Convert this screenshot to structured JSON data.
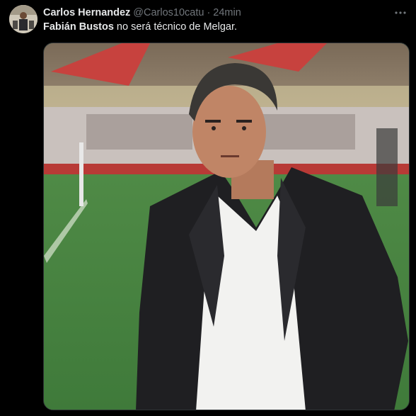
{
  "tweet": {
    "author_name": "Carlos Hernandez",
    "handle": "@Carlos10catu",
    "separator": "·",
    "time": "24min",
    "text_bold": "Fabián Bustos",
    "text_rest": " no será técnico de Melgar."
  },
  "icons": {
    "more": "more-horizontal-icon",
    "avatar": "user-avatar"
  },
  "colors": {
    "background": "#000000",
    "text_primary": "#e7e9ea",
    "text_secondary": "#71767b",
    "border": "#2f3336"
  }
}
